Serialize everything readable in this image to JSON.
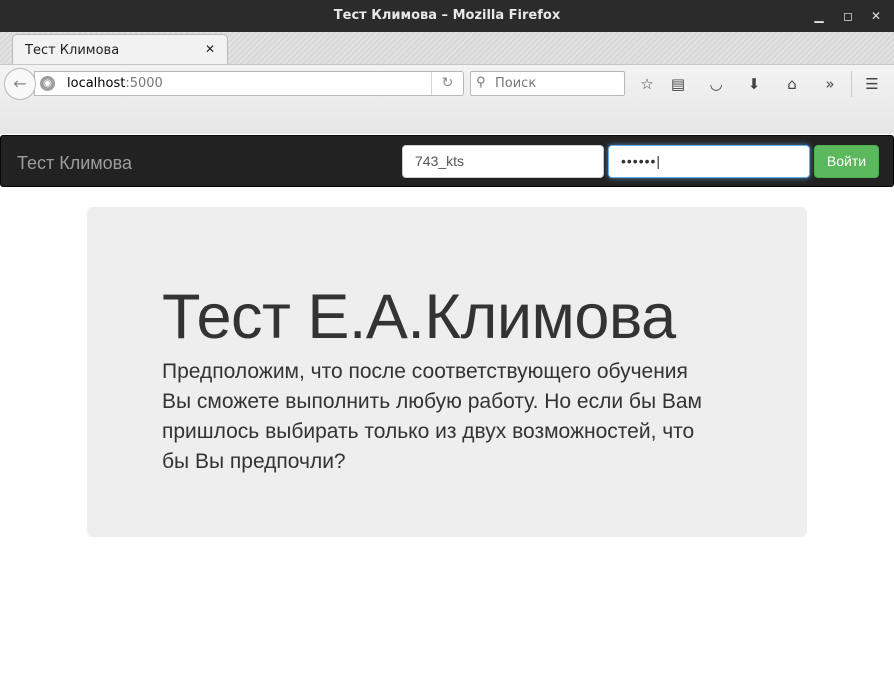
{
  "window": {
    "title": "Тест Климова – Mozilla Firefox"
  },
  "tabs": [
    {
      "label": "Тест Климова"
    }
  ],
  "address": {
    "host": "localhost",
    "port": ":5000"
  },
  "search": {
    "placeholder": "Поиск"
  },
  "toolbar_icons": [
    "bookmark-star-icon",
    "reading-list-icon",
    "pocket-icon",
    "download-icon",
    "home-icon",
    "overflow-chevron-icon",
    "menu-icon"
  ],
  "site": {
    "brand": "Тест Климова",
    "login": {
      "username": "743_kts",
      "password_mask": "••••••",
      "submit_label": "Войти"
    }
  },
  "hero": {
    "heading": "Тест Е.А.Климова",
    "text": "Предположим, что после соответствующего обучения Вы сможете выполнить любую работу. Но если бы Вам пришлось выбирать только из двух возможностей, что бы Вы предпочли?"
  },
  "colors": {
    "navbar": "#222222",
    "button": "#5cb85c",
    "jumbotron": "#eeeeee"
  }
}
